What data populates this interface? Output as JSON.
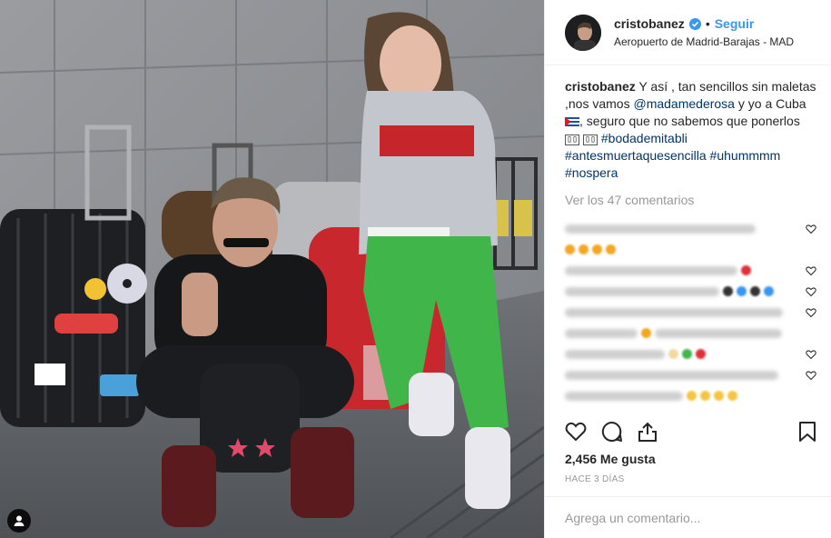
{
  "header": {
    "username": "cristobanez",
    "follow_label": "Seguir",
    "separator": "•",
    "location": "Aeropuerto de Madrid-Barajas - MAD"
  },
  "caption": {
    "username": "cristobanez",
    "part1": "Y así , tan sencillos sin maletas ,nos vamos",
    "mention": "@madamederosa",
    "part2": "y yo a Cuba",
    "part3": ", seguro que no sabemos que ponerlos",
    "glyphs": "",
    "hashtag1": "#bodademitabli",
    "hashtag2": "#antesmuertaquesencilla",
    "hashtag3": "#uhummmm",
    "hashtag4": "#nospera"
  },
  "view_all_comments": "Ver los 47 comentarios",
  "likes": "2,456 Me gusta",
  "time_ago": "HACE 3 DÍAS",
  "comment_input": {
    "placeholder": "Agrega un comentario..."
  },
  "colors": {
    "accent": "#3897f0",
    "text": "#262626",
    "muted": "#999999",
    "link": "#003569",
    "pants_green": "#3fb54a"
  },
  "icons": {
    "like": "heart-outline-icon",
    "comment": "comment-bubble-icon",
    "share": "share-upload-icon",
    "save": "bookmark-icon",
    "tag": "user-tag-icon",
    "verified": "verified-badge-icon"
  }
}
